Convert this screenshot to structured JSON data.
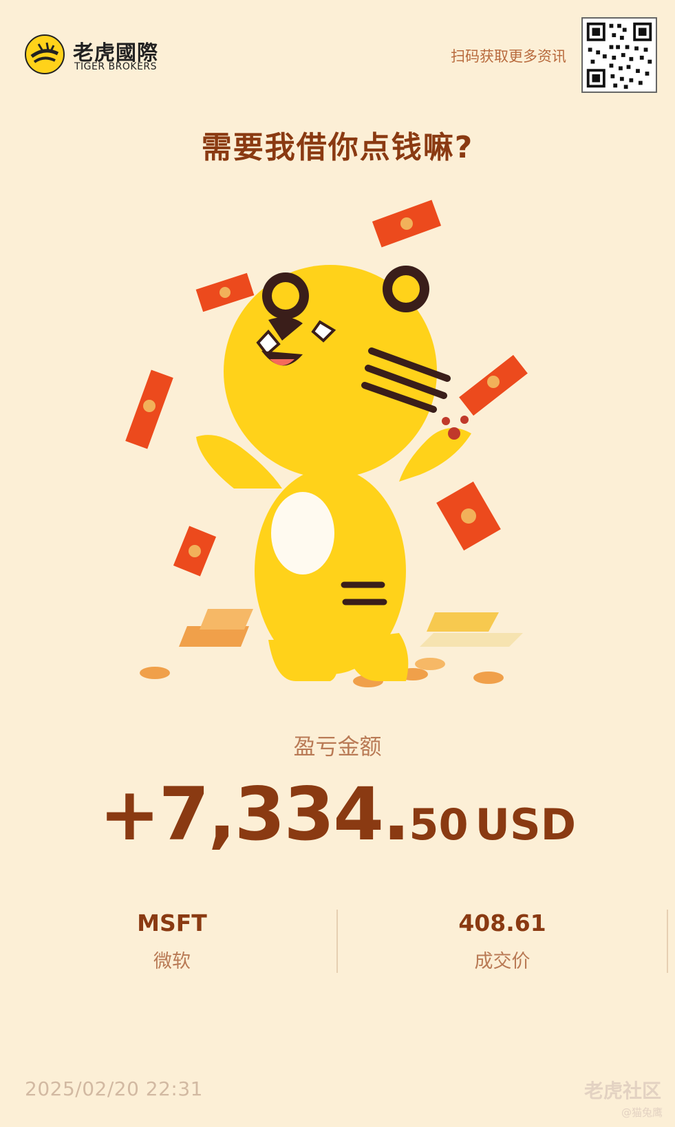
{
  "header": {
    "brand_cn": "老虎國際",
    "brand_en": "TIGER BROKERS",
    "scan_text": "扫码获取更多资讯"
  },
  "headline": "需要我借你点钱嘛?",
  "pnl": {
    "label": "盈亏金额",
    "integer": "+7,334.",
    "decimal": "50",
    "currency": "USD"
  },
  "stock": {
    "symbol": "MSFT",
    "name": "微软"
  },
  "trade": {
    "price": "408.61",
    "price_label": "成交价"
  },
  "timestamp": "2025/02/20 22:31",
  "watermark": {
    "text": "老虎社区",
    "user": "@猫兔鹰"
  },
  "colors": {
    "background": "#fcefd6",
    "primary_text": "#8a3a12",
    "secondary_text": "#b97a55",
    "tiger_yellow": "#ffd21a",
    "red_packet": "#ec4a1d"
  }
}
